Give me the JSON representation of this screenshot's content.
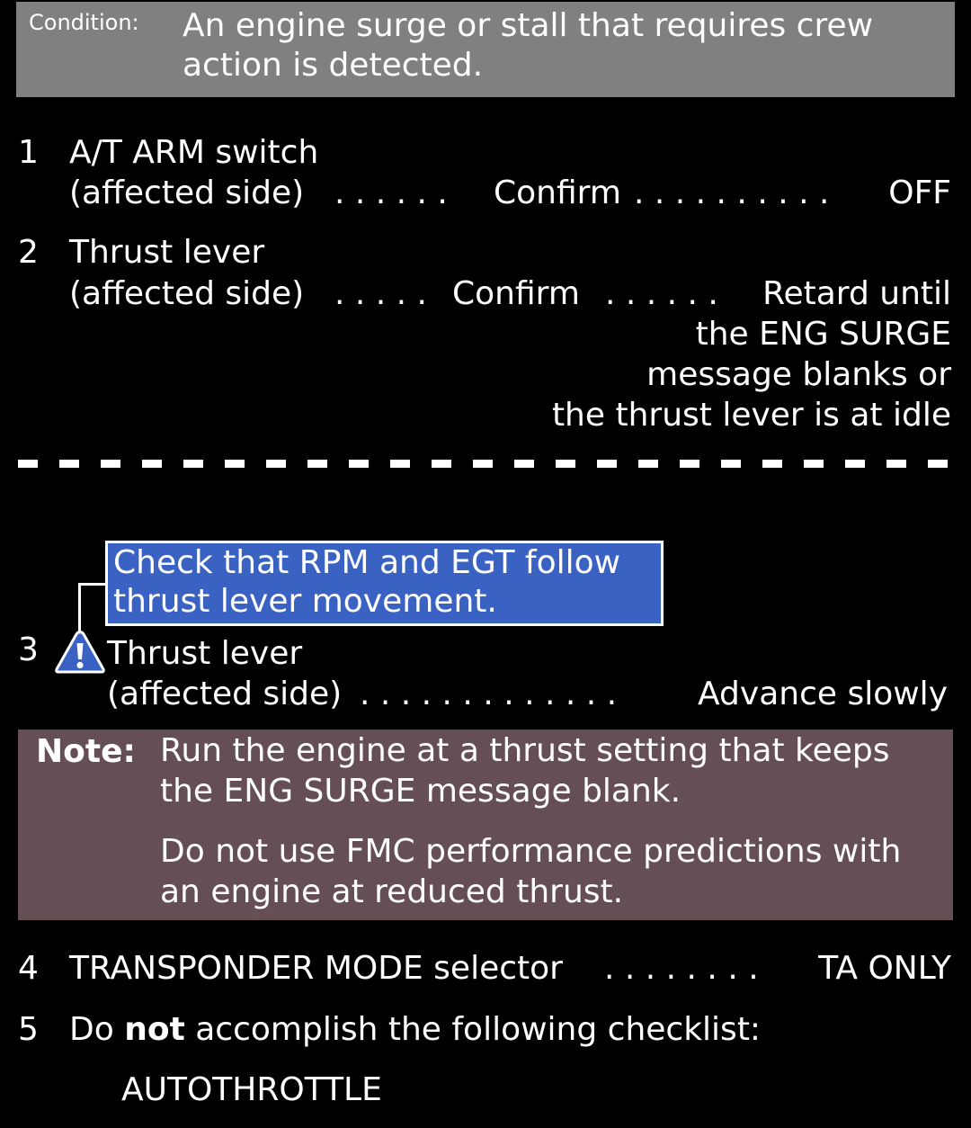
{
  "condition": {
    "label": "Condition:",
    "text": "An engine surge or stall that requires crew action is detected."
  },
  "steps": {
    "s1": {
      "number": "1",
      "item": "A/T ARM switch",
      "qualifier": "(affected side)",
      "dots1": ". . . . . .",
      "action": "Confirm",
      "dots2": ". . . . . . . . . .",
      "value": "OFF"
    },
    "s2": {
      "number": "2",
      "item": "Thrust lever",
      "qualifier": "(affected side)",
      "dots1": ". . . . .",
      "action": "Confirm",
      "dots2": ". . . . . .",
      "value_lines": [
        "Retard until",
        "the ENG SURGE",
        "message blanks or",
        "the thrust lever is at idle"
      ]
    },
    "caution": {
      "text": "Check that RPM and EGT follow thrust lever movement.",
      "icon": "caution-triangle-icon"
    },
    "s3": {
      "number": "3",
      "item": "Thrust lever",
      "qualifier": "(affected side)",
      "dots": ". . . . . . . . . . . . .",
      "value": "Advance slowly"
    },
    "note": {
      "label": "Note:",
      "p1": "Run the engine at a thrust setting that keeps the ENG SURGE message blank.",
      "p2": "Do not use FMC performance predictions with an engine at reduced thrust."
    },
    "s4": {
      "number": "4",
      "item": "TRANSPONDER MODE selector",
      "dots": ". . . . . . . .",
      "value": "TA ONLY"
    },
    "s5": {
      "number": "5",
      "pre": "Do",
      "emph": "not",
      "post": "accomplish the following checklist:",
      "checklist": "AUTOTHROTTLE"
    }
  },
  "colors": {
    "background": "#000000",
    "condition_box": "#808080",
    "caution_box": "#3a62c2",
    "note_box": "#664f54",
    "text": "#ffffff"
  }
}
